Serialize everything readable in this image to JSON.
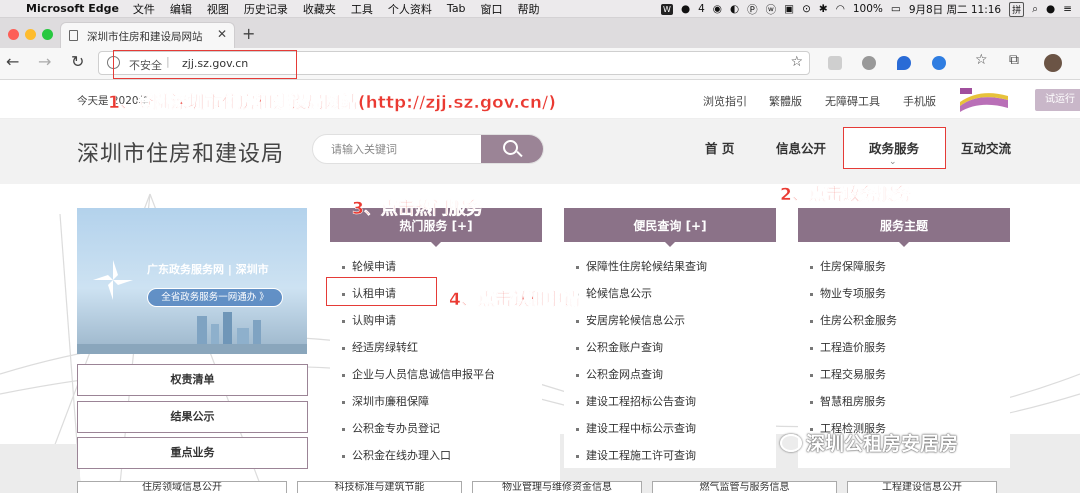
{
  "menubar": {
    "app_name": "Microsoft Edge",
    "items": [
      "文件",
      "编辑",
      "视图",
      "历史记录",
      "收藏夹",
      "工具",
      "个人资料",
      "Tab",
      "窗口",
      "帮助"
    ],
    "badge_count": "4",
    "battery": "100%",
    "datetime": "9月8日 周二  11:16",
    "ime": "拼"
  },
  "browser": {
    "tab_title": "深圳市住房和建设局网站",
    "new_tab": "+",
    "security_label": "不安全",
    "url": "zjj.sz.gov.cn"
  },
  "topstrip": {
    "date_text": "今天是 2020年",
    "links": [
      "浏览指引",
      "繁體版",
      "无障碍工具",
      "手机版"
    ],
    "trial_button": "试运行"
  },
  "header": {
    "site_title": "深圳市住房和建设局",
    "search_placeholder": "请输入关键词",
    "nav": [
      "首 页",
      "信息公开",
      "政务服务",
      "互动交流"
    ]
  },
  "banner": {
    "gov_text": "广东政务服务网 | 深圳市",
    "pill_text": "全省政务服务一网通办 》"
  },
  "sidebar_buttons": [
    "权责清单",
    "结果公示",
    "重点业务"
  ],
  "columns": [
    {
      "title": "热门服务 [+]",
      "items": [
        "轮候申请",
        "认租申请",
        "认购申请",
        "经适房绿转红",
        "企业与人员信息诚信申报平台",
        "深圳市廉租保障",
        "公积金专办员登记",
        "公积金在线办理入口"
      ]
    },
    {
      "title": "便民查询 [+]",
      "items": [
        "保障性住房轮候结果查询",
        "轮候信息公示",
        "安居房轮候信息公示",
        "公积金账户查询",
        "公积金网点查询",
        "建设工程招标公告查询",
        "建设工程中标公示查询",
        "建设工程施工许可查询"
      ]
    },
    {
      "title": "服务主题",
      "items": [
        "住房保障服务",
        "物业专项服务",
        "住房公积金服务",
        "工程造价服务",
        "工程交易服务",
        "智慧租房服务",
        "工程检测服务"
      ]
    }
  ],
  "bottom_buttons": [
    "住房领域信息公开",
    "科技标准与建筑节能",
    "物业管理与维修资金信息",
    "燃气监管与服务信息",
    "工程建设信息公开"
  ],
  "annotations": {
    "step1": "1、登陆深圳市住房和建设局网站(http://zjj.sz.gov.cn/)",
    "step2": "2、点击政务服务",
    "step3": "3、点击热门服务",
    "step4": "4、点击认租申请"
  },
  "watermark": "深圳公租房安居房",
  "colors": {
    "accent": "#8b7288",
    "annotation": "#ea3a32",
    "header_bg": "#f2f2f2"
  }
}
